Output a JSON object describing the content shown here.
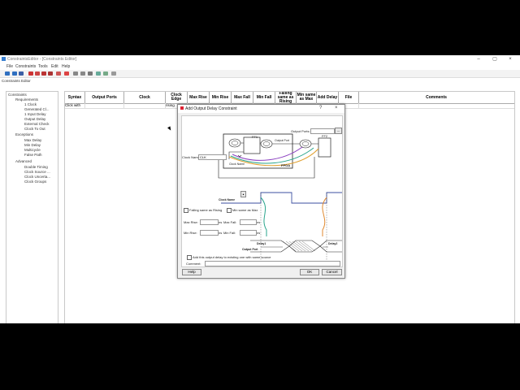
{
  "window": {
    "title": "ConstraintsEditor - [Constraints Editor]"
  },
  "menu": [
    "File",
    "Constraints",
    "Tools",
    "Edit",
    "Help"
  ],
  "panel_caption": "Constraints Editor",
  "tree": [
    "Constraints",
    "Requirements",
    "1 Clock",
    "Generated Cl...",
    "1 Input Delay",
    "Output Delay",
    "External Check",
    "Clock To Out",
    "Exceptions",
    "Max Delay",
    "Min Delay",
    "Multicycle",
    "False Path",
    "Advanced",
    "Double Timing",
    "Clock Source ...",
    "Clock Uncerta...",
    "Clock Groups"
  ],
  "grid": {
    "headers": [
      "Syntax",
      "Output Ports",
      "Clock",
      "Clock Edge",
      "Max Rise",
      "Min Rise",
      "Max Fall",
      "Min Fall",
      "Falling same as Rising",
      "Min same as Max",
      "Add Delay",
      "File",
      "Comments"
    ],
    "row": [
      "Click with",
      "",
      "",
      "rising",
      "",
      "",
      "",
      "",
      "",
      "",
      "",
      "",
      ""
    ]
  },
  "dialog": {
    "title": "Add Output Delay Constraint",
    "help_glyph": "?",
    "close_glyph": "×",
    "output_ports_label": "Output Ports:",
    "output_ports_browse": "...",
    "clock_name_label": "Clock Name:",
    "clock_name_value": "CLK",
    "ff1": "FF1",
    "ff2": "FF2",
    "output_port_tag": "Output Port",
    "clock_name_tag": "Clock Name",
    "fpga_tag": "FPGA",
    "wave_clock_label": "Clock Name",
    "falling_same": "Falling same as Rising",
    "min_same": "Min same as Max",
    "max_rise": "Max Rise:",
    "max_fall": "Max Fall:",
    "min_rise": "Min Rise:",
    "min_fall": "Min Fall:",
    "ns": "ns",
    "delay1": "Delay1",
    "delay2": "Delay2",
    "output_port_wave": "Output Port",
    "add_existing": "Add this output delay to existing one with same source",
    "comment_label": "Comment:",
    "help": "Help",
    "ok": "OK",
    "cancel": "Cancel"
  }
}
